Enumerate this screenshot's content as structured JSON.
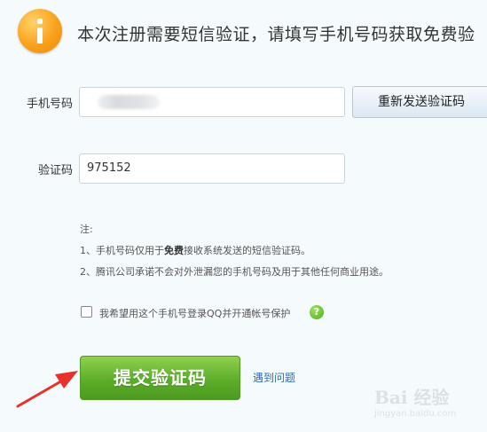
{
  "header": {
    "message": "本次注册需要短信验证，请填写手机号码获取免费验"
  },
  "form": {
    "phone_label": "手机号码",
    "phone_value": "",
    "resend_label": "重新发送验证码",
    "code_label": "验证码",
    "code_value": "975152"
  },
  "notes": {
    "title": "注:",
    "line1_prefix": "1、手机号码仅用于",
    "line1_bold": "免费",
    "line1_suffix": "接收系统发送的短信验证码。",
    "line2": "2、腾讯公司承诺不会对外泄漏您的手机号码及用于其他任何商业用途。"
  },
  "option": {
    "checkbox_label": "我希望用这个手机号登录QQ并开通帐号保护",
    "checked": false,
    "help_glyph": "?"
  },
  "actions": {
    "submit_label": "提交验证码",
    "help_link": "遇到问题"
  },
  "watermark": {
    "logo": "Bai 经验",
    "url": "jingyan.baidu.com"
  },
  "colors": {
    "info_icon": "#f9a11b",
    "submit_button": "#5cae2a",
    "link": "#2a6fb5",
    "annotation_arrow": "#e8312a"
  },
  "icons": {
    "info": "info-icon",
    "help": "question-icon",
    "arrow": "arrow-icon"
  }
}
